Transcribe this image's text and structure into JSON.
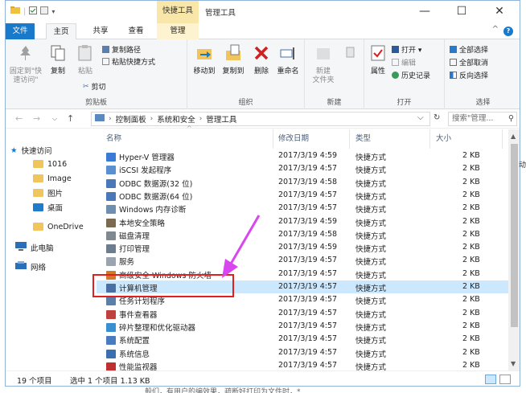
{
  "titlebar": {
    "context_tab_title": "快捷工具",
    "window_title": "管理工具",
    "minimize": "—",
    "maximize": "☐",
    "close": "✕"
  },
  "ribbon_tabs": [
    {
      "label": "文件"
    },
    {
      "label": "主页"
    },
    {
      "label": "共享"
    },
    {
      "label": "查看"
    },
    {
      "label": "管理"
    }
  ],
  "ribbon": {
    "clipboard": {
      "pin_label": "固定到\"快速访问\"",
      "copy": "复制",
      "paste": "粘贴",
      "copy_path": "复制路径",
      "paste_shortcut": "粘贴快捷方式",
      "cut": "剪切",
      "group": "剪贴板"
    },
    "organize": {
      "move_to": "移动到",
      "copy_to": "复制到",
      "delete": "删除",
      "rename": "重命名",
      "group": "组织"
    },
    "new": {
      "new_folder": "新建\n文件夹",
      "group": "新建"
    },
    "open": {
      "properties": "属性",
      "open": "打开 ▾",
      "edit": "编辑",
      "history": "历史记录",
      "group": "打开"
    },
    "select": {
      "select_all": "全部选择",
      "select_none": "全部取消",
      "invert": "反向选择",
      "group": "选择"
    }
  },
  "address": {
    "crumbs": [
      "控制面板",
      "系统和安全",
      "管理工具"
    ],
    "search_placeholder": "搜索\"管理...",
    "dropdown": "⌵",
    "refresh": "↻"
  },
  "nav": [
    {
      "label": "快速访问"
    },
    {
      "label": "1016"
    },
    {
      "label": "Image"
    },
    {
      "label": "图片"
    },
    {
      "label": "桌面"
    },
    {
      "label": "OneDrive"
    },
    {
      "label": "此电脑"
    },
    {
      "label": "网络"
    }
  ],
  "columns": {
    "name": "名称",
    "date": "修改日期",
    "type": "类型",
    "size": "大小"
  },
  "files": [
    {
      "name": "Hyper-V 管理器",
      "date": "2017/3/19 4:59",
      "type": "快捷方式",
      "size": "2 KB",
      "color": "#3a7bd5"
    },
    {
      "name": "iSCSI 发起程序",
      "date": "2017/3/19 4:57",
      "type": "快捷方式",
      "size": "2 KB",
      "color": "#5a8fd0"
    },
    {
      "name": "ODBC 数据源(32 位)",
      "date": "2017/3/19 4:58",
      "type": "快捷方式",
      "size": "2 KB",
      "color": "#4a78b8"
    },
    {
      "name": "ODBC 数据源(64 位)",
      "date": "2017/3/19 4:57",
      "type": "快捷方式",
      "size": "2 KB",
      "color": "#4a78b8"
    },
    {
      "name": "Windows 内存诊断",
      "date": "2017/3/19 4:57",
      "type": "快捷方式",
      "size": "2 KB",
      "color": "#6f8fb0"
    },
    {
      "name": "本地安全策略",
      "date": "2017/3/19 4:59",
      "type": "快捷方式",
      "size": "2 KB",
      "color": "#7a6a50"
    },
    {
      "name": "磁盘清理",
      "date": "2017/3/19 4:58",
      "type": "快捷方式",
      "size": "2 KB",
      "color": "#808890"
    },
    {
      "name": "打印管理",
      "date": "2017/3/19 4:59",
      "type": "快捷方式",
      "size": "2 KB",
      "color": "#6d7d8d"
    },
    {
      "name": "服务",
      "date": "2017/3/19 4:57",
      "type": "快捷方式",
      "size": "2 KB",
      "color": "#9aa4ae"
    },
    {
      "name": "高级安全 Windows 防火墙",
      "date": "2017/3/19 4:57",
      "type": "快捷方式",
      "size": "2 KB",
      "color": "#d07a2a"
    },
    {
      "name": "计算机管理",
      "date": "2017/3/19 4:57",
      "type": "快捷方式",
      "size": "2 KB",
      "color": "#4a6fa5",
      "selected": true
    },
    {
      "name": "任务计划程序",
      "date": "2017/3/19 4:57",
      "type": "快捷方式",
      "size": "2 KB",
      "color": "#5a7fa8"
    },
    {
      "name": "事件查看器",
      "date": "2017/3/19 4:57",
      "type": "快捷方式",
      "size": "2 KB",
      "color": "#c04040"
    },
    {
      "name": "碎片整理和优化驱动器",
      "date": "2017/3/19 4:57",
      "type": "快捷方式",
      "size": "2 KB",
      "color": "#3a8fd0"
    },
    {
      "name": "系统配置",
      "date": "2017/3/19 4:57",
      "type": "快捷方式",
      "size": "2 KB",
      "color": "#4a7ac0"
    },
    {
      "name": "系统信息",
      "date": "2017/3/19 4:57",
      "type": "快捷方式",
      "size": "2 KB",
      "color": "#3a6fb0"
    },
    {
      "name": "性能监视器",
      "date": "2017/3/19 4:57",
      "type": "快捷方式",
      "size": "2 KB",
      "color": "#c03030"
    }
  ],
  "status": {
    "count": "19 个项目",
    "selection": "选中 1 个项目  1.13 KB"
  },
  "background": {
    "right_text": "动",
    "bottom_text": "般们，有用户的编效果，疏断好打印为文件时，*"
  },
  "colors": {
    "accent": "#1979ca",
    "selection": "#cce8ff",
    "annotation": "#e02020",
    "arrow": "#d946ef"
  }
}
